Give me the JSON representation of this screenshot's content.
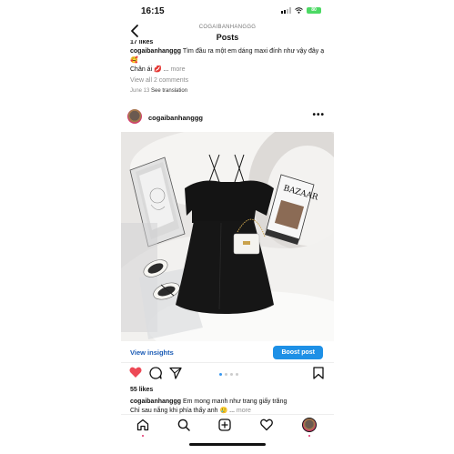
{
  "status_bar": {
    "time": "16:15",
    "battery": "80"
  },
  "header": {
    "username": "COGAIBANHANGGG",
    "title": "Posts"
  },
  "previous_post": {
    "likes": "17 likes",
    "caption_user": "cogaibanhanggg",
    "caption_text": "Tìm đầu ra một em dáng maxi đính như vậy đây ạ 🥰",
    "caption_line2": "Chân ái 💋 ...",
    "more": "more",
    "view_comments": "View all 2 comments",
    "date": "June 13",
    "see_translation": "See translation"
  },
  "post": {
    "username": "cogaibanhanggg",
    "magazine_text": "BAZAAR",
    "view_insights": "View insights",
    "boost_post": "Boost post",
    "likes": "55 likes",
    "caption_user": "cogaibanhanggg",
    "caption_text": "Em mong manh như trang giấy trắng",
    "caption_line2": "Chỉ sau nắng khi phía thấy anh 🥲 ...",
    "more": "more"
  },
  "colors": {
    "accent": "#1e90e6",
    "like_red": "#ed4956",
    "link_blue": "#1a5bb5"
  },
  "icons": [
    "back-icon",
    "more-options-icon",
    "heart-icon",
    "comment-icon",
    "share-icon",
    "save-icon",
    "home-icon",
    "search-icon",
    "add-icon",
    "activity-icon",
    "profile-icon"
  ]
}
